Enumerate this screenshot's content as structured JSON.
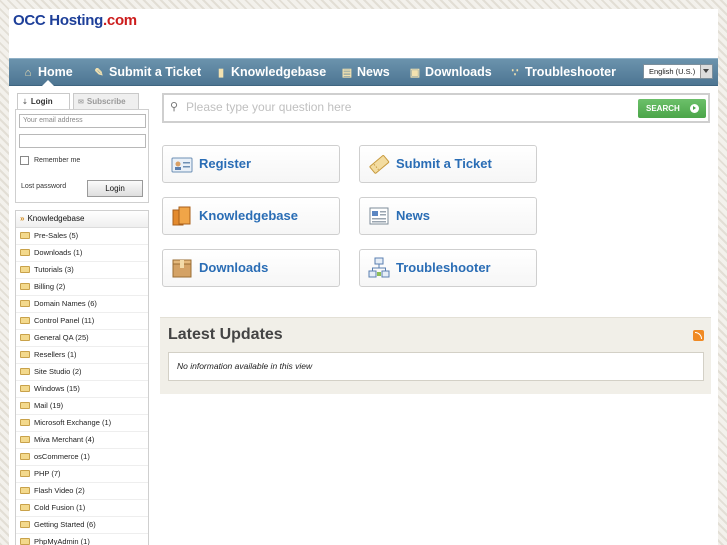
{
  "logo": {
    "part1": "OCC Hosting",
    "part2": ".com"
  },
  "nav": {
    "items": [
      {
        "label": "Home",
        "icon": "home-icon"
      },
      {
        "label": "Submit a Ticket",
        "icon": "ticket-icon"
      },
      {
        "label": "Knowledgebase",
        "icon": "book-icon"
      },
      {
        "label": "News",
        "icon": "news-icon"
      },
      {
        "label": "Downloads",
        "icon": "box-icon"
      },
      {
        "label": "Troubleshooter",
        "icon": "network-icon"
      }
    ],
    "language": "English (U.S.)"
  },
  "login": {
    "tab_login": "Login",
    "tab_subscribe": "Subscribe",
    "email_placeholder": "Your email address",
    "remember_me": "Remember me",
    "lost_password": "Lost password",
    "button": "Login"
  },
  "knowledgebase": {
    "title": "Knowledgebase",
    "items": [
      "Pre-Sales (5)",
      "Downloads (1)",
      "Tutorials (3)",
      "Billing (2)",
      "Domain Names (6)",
      "Control Panel (11)",
      "General QA (25)",
      "Resellers (1)",
      "Site Studio (2)",
      "Windows (15)",
      "Mail (19)",
      "Microsoft Exchange (1)",
      "Miva Merchant (4)",
      "osCommerce (1)",
      "PHP (7)",
      "Flash Video (2)",
      "Cold Fusion (1)",
      "Getting Started (6)",
      "PhpMyAdmin (1)"
    ]
  },
  "search": {
    "placeholder": "Please type your question here",
    "button": "SEARCH"
  },
  "tiles": {
    "register": "Register",
    "submit_ticket": "Submit a Ticket",
    "knowledgebase": "Knowledgebase",
    "news": "News",
    "downloads": "Downloads",
    "troubleshooter": "Troubleshooter"
  },
  "updates": {
    "title": "Latest Updates",
    "empty": "No information available in this view"
  },
  "colors": {
    "nav": "#5a829f",
    "accent_text": "#2a6db5",
    "search_button": "#52aa50",
    "logo_blue": "#1d3f99",
    "logo_red": "#cc1c1c"
  }
}
